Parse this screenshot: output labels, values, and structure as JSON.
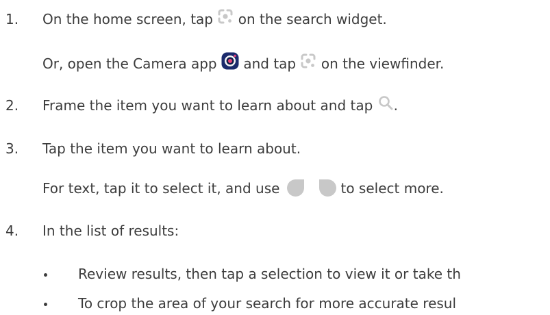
{
  "steps": [
    {
      "number": "1.",
      "parts": [
        "On the home screen, tap",
        "on the search widget."
      ],
      "sub": [
        "Or, open the Camera app",
        "and tap",
        "on the viewfinder."
      ]
    },
    {
      "number": "2.",
      "parts": [
        "Frame the item you want to learn about and tap",
        "."
      ]
    },
    {
      "number": "3.",
      "text": "Tap the item you want to learn about.",
      "sub": [
        "For text, tap it to select it, and use",
        "to select more."
      ]
    },
    {
      "number": "4.",
      "text": "In the list of results:",
      "bullets": [
        "Review results, then tap a selection to view it or take th",
        "To crop the area of your search for more accurate resul"
      ]
    }
  ],
  "icons": {
    "lens": "lens-icon",
    "camera_app": "camera-app-icon",
    "search": "search-icon",
    "handle_left": "selection-handle-left-icon",
    "handle_right": "selection-handle-right-icon"
  },
  "colors": {
    "text": "#3c3c3c",
    "icon_gray": "#c8c8c8",
    "camera_blue": "#1a2a6c",
    "camera_accent": "#e8407a"
  }
}
